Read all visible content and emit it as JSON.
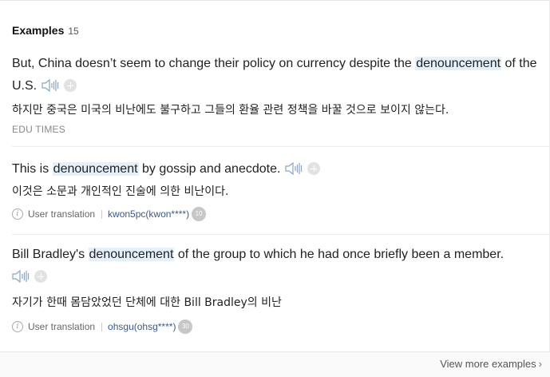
{
  "header": {
    "title": "Examples",
    "count": "15"
  },
  "examples": [
    {
      "en_before": "But, China doesn’t seem to change their policy on currency despite the ",
      "en_highlight": "denouncement",
      "en_after": " of the U.S.",
      "ko": "하지만 중국은 미국의 비난에도 불구하고 그들의 환율 관련 정책을 바꿀 것으로 보이지 않는다.",
      "source": "EDU TIMES"
    },
    {
      "en_before": "This is ",
      "en_highlight": "denouncement",
      "en_after": " by gossip and anecdote.",
      "ko": "이것은 소문과 개인적인 진술에 의한 비난이다.",
      "meta_label": "User translation",
      "user": "kwon5pc(kwon****)",
      "level": "10"
    },
    {
      "en_before": "Bill Bradley's ",
      "en_highlight": "denouncement",
      "en_after": " of the group to which he had once briefly been a member.",
      "ko": "자기가 한때 몸담았었던 단체에 대한 Bill Bradley의 비난",
      "meta_label": "User translation",
      "user": "ohsgu(ohsg****)",
      "level": "30"
    }
  ],
  "icons": {
    "speaker": "speaker-icon",
    "add": "plus-icon",
    "info": "info-icon",
    "more": "chevron-right-icon"
  },
  "footer": {
    "more_label": "View more examples"
  }
}
